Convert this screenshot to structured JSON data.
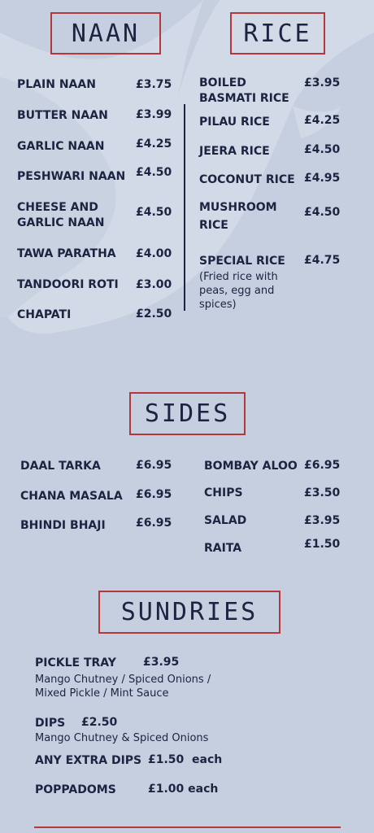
{
  "naan": {
    "title": "NAAN",
    "items": [
      {
        "name": "PLAIN NAAN",
        "price": "£3.75"
      },
      {
        "name": "BUTTER NAAN",
        "price": "£3.99"
      },
      {
        "name": "GARLIC NAAN",
        "price": "£4.25"
      },
      {
        "name": "PESHWARI NAAN",
        "price": "£4.50"
      },
      {
        "name": "CHEESE AND GARLIC NAAN",
        "price": "£4.50"
      },
      {
        "name": "TAWA PARATHA",
        "price": "£4.00"
      },
      {
        "name": "TANDOORI ROTI",
        "price": "£3.00"
      },
      {
        "name": "CHAPATI",
        "price": "£2.50"
      }
    ]
  },
  "rice": {
    "title": "RICE",
    "items": [
      {
        "name": "BOILED BASMATI RICE",
        "price": "£3.95"
      },
      {
        "name": "PILAU RICE",
        "price": "£4.25"
      },
      {
        "name": "JEERA RICE",
        "price": "£4.50"
      },
      {
        "name": "COCONUT RICE",
        "price": "£4.95"
      },
      {
        "name": "MUSHROOM RICE",
        "price": "£4.50"
      },
      {
        "name": "SPECIAL RICE",
        "price": "£4.75",
        "note": "(Fried rice with peas, egg and spices)"
      }
    ]
  },
  "sides": {
    "title": "SIDES",
    "items": [
      {
        "name": "DAAL TARKA",
        "price": "£6.95"
      },
      {
        "name": "CHANA MASALA",
        "price": "£6.95"
      },
      {
        "name": "BHINDI BHAJI",
        "price": "£6.95"
      },
      {
        "name": "BOMBAY ALOO",
        "price": "£6.95"
      },
      {
        "name": "CHIPS",
        "price": "£3.50"
      },
      {
        "name": "SALAD",
        "price": "£3.95"
      },
      {
        "name": "RAITA",
        "price": "£1.50"
      }
    ]
  },
  "sundries": {
    "title": "SUNDRIES",
    "pickle_tray": {
      "name": "PICKLE TRAY",
      "price": "£3.95",
      "note": "Mango Chutney / Spiced Onions / Mixed Pickle / Mint Sauce"
    },
    "dips": {
      "name": "DIPS",
      "price": "£2.50",
      "note": "Mango Chutney & Spiced Onions"
    },
    "extra_dips": {
      "name": "ANY EXTRA DIPS",
      "price": "£1.50  each"
    },
    "poppadoms": {
      "name": "POPPADOMS",
      "price": "£1.00 each"
    }
  },
  "colors": {
    "background": "#c5cfdf",
    "text": "#1b2440",
    "accent_red": "#b3383c"
  }
}
